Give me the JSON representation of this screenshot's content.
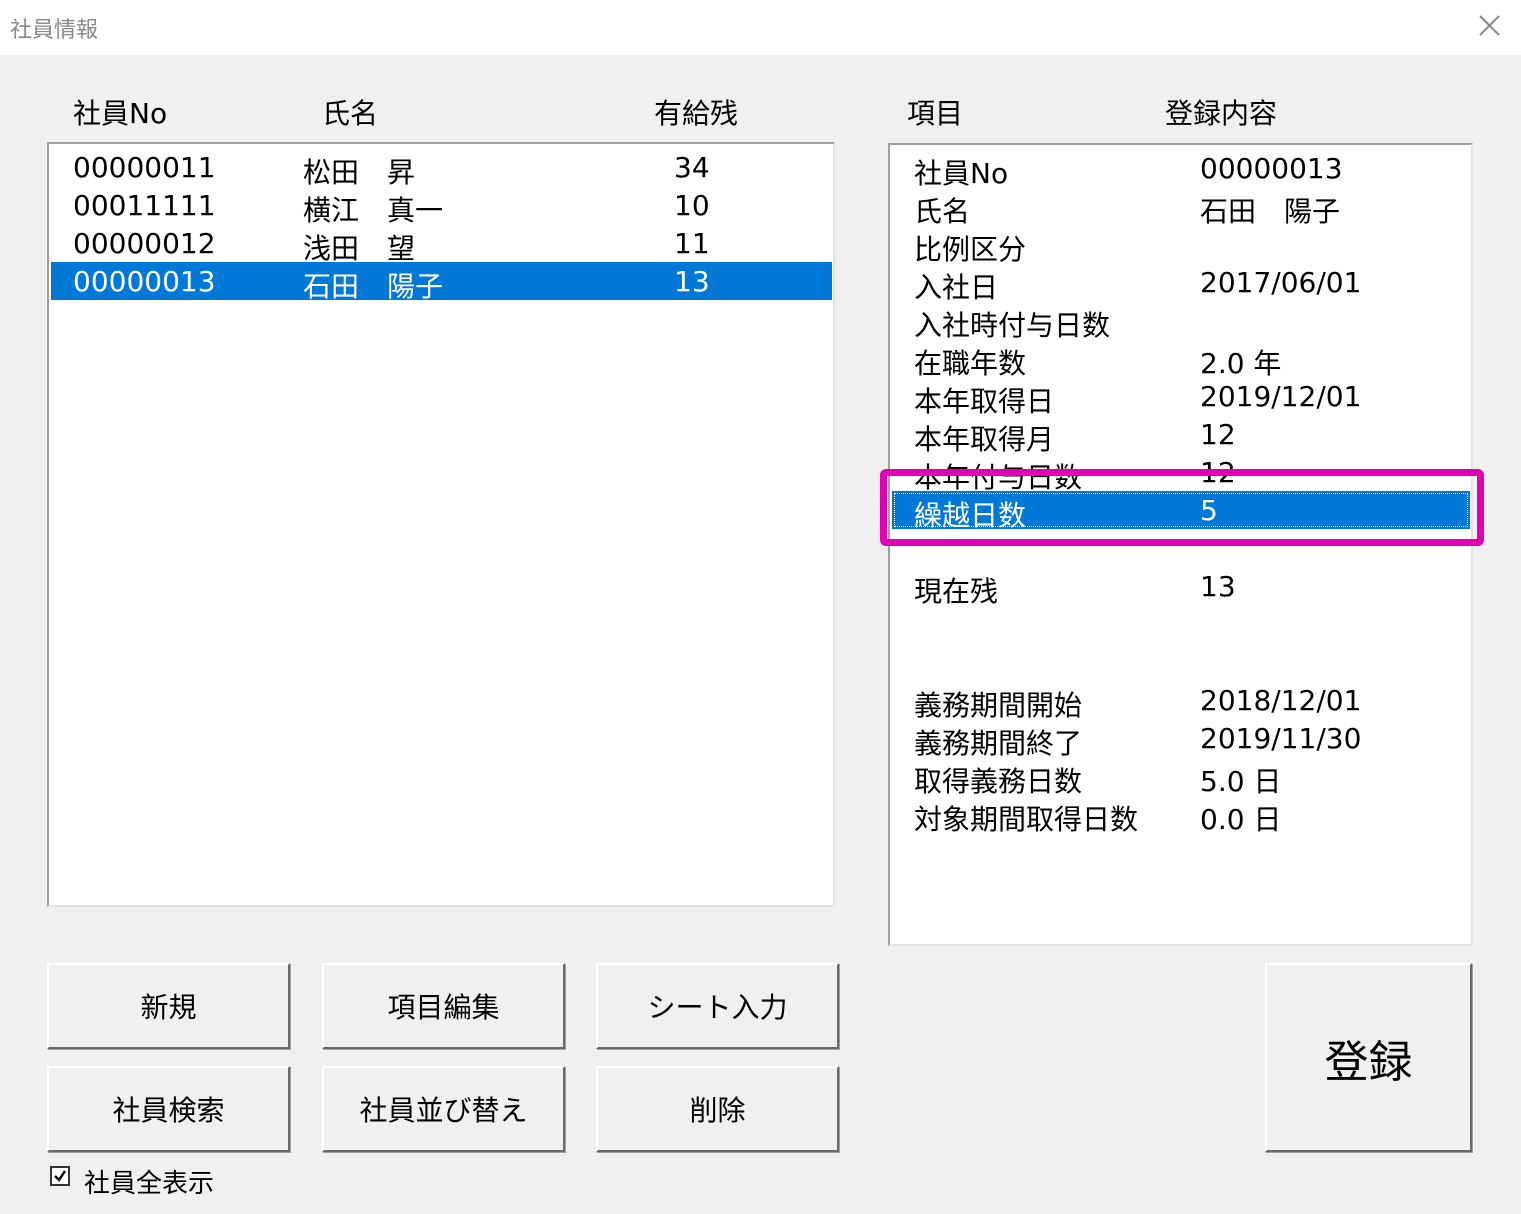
{
  "window": {
    "title": "社員情報"
  },
  "list_headers": {
    "no": "社員No",
    "name": "氏名",
    "paid_leave": "有給残"
  },
  "employees": [
    {
      "no": "00000011",
      "name": "松田　昇",
      "paid_leave": "34"
    },
    {
      "no": "00011111",
      "name": "横江　真一",
      "paid_leave": "10"
    },
    {
      "no": "00000012",
      "name": "浅田　望",
      "paid_leave": "11"
    },
    {
      "no": "00000013",
      "name": "石田　陽子",
      "paid_leave": "13"
    }
  ],
  "selected_employee_index": 3,
  "detail_headers": {
    "item": "項目",
    "content": "登録内容"
  },
  "details": [
    {
      "item": "社員No",
      "value": "00000013"
    },
    {
      "item": "氏名",
      "value": "石田　陽子"
    },
    {
      "item": "比例区分",
      "value": ""
    },
    {
      "item": "入社日",
      "value": "2017/06/01"
    },
    {
      "item": "入社時付与日数",
      "value": ""
    },
    {
      "item": "在職年数",
      "value": "2.0 年"
    },
    {
      "item": "本年取得日",
      "value": "2019/12/01"
    },
    {
      "item": "本年取得月",
      "value": "12"
    },
    {
      "item": "本年付与日数",
      "value": "12"
    },
    {
      "item": "繰越日数",
      "value": "5"
    },
    {
      "item": "現在残",
      "value": "13"
    },
    {
      "item": "義務期間開始",
      "value": "2018/12/01"
    },
    {
      "item": "義務期間終了",
      "value": "2019/11/30"
    },
    {
      "item": "取得義務日数",
      "value": "5.0 日"
    },
    {
      "item": "対象期間取得日数",
      "value": "0.0 日"
    }
  ],
  "selected_detail_index": 9,
  "highlight_color": "#e100b4",
  "selection_color": "#0078d7",
  "buttons": {
    "new": "新規",
    "edit_items": "項目編集",
    "sheet_input": "シート入力",
    "search": "社員検索",
    "sort": "社員並び替え",
    "delete": "削除",
    "register": "登録"
  },
  "checkbox": {
    "label": "社員全表示",
    "checked": true
  }
}
